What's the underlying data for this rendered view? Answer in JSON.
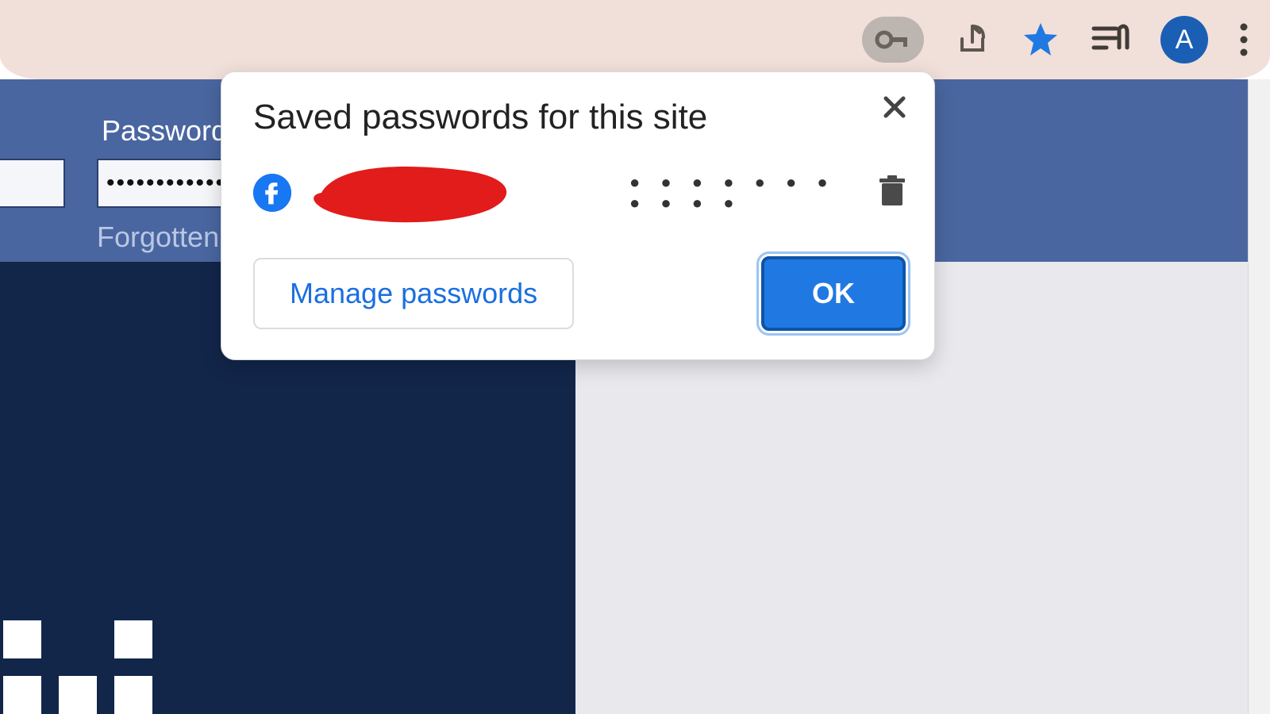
{
  "toolbar": {
    "avatar_initial": "A"
  },
  "background_page": {
    "password_label": "Password",
    "password_value_masked": "•••••••••••••••",
    "forgotten_link": "Forgotten"
  },
  "popup": {
    "title": "Saved passwords for this site",
    "entry": {
      "site": "facebook",
      "username_redacted": true,
      "password_masked": "● ● ● ● ● ● ● ● ● ● ●"
    },
    "manage_label": "Manage passwords",
    "ok_label": "OK"
  }
}
